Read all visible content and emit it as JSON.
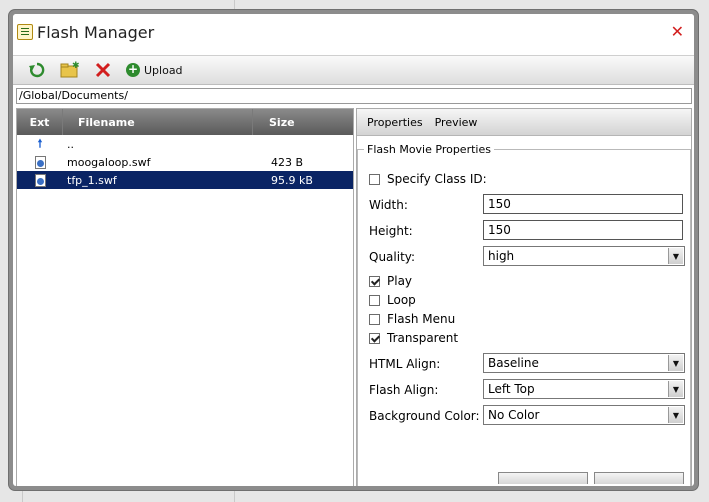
{
  "dialog": {
    "title": "Flash Manager",
    "close_icon": "close-icon"
  },
  "toolbar": {
    "refresh_icon": "refresh-icon",
    "new_folder_icon": "new-folder-icon",
    "delete_icon": "delete-icon",
    "upload_label": "Upload"
  },
  "path": {
    "value": "/Global/Documents/"
  },
  "file_list": {
    "columns": [
      "Ext",
      "Filename",
      "Size"
    ],
    "rows": [
      {
        "icon": "up-arrow-icon",
        "name": "..",
        "size": ""
      },
      {
        "icon": "swf-file-icon",
        "name": "moogaloop.swf",
        "size": "423 B"
      },
      {
        "icon": "swf-file-icon",
        "name": "tfp_1.swf",
        "size": "95.9 kB",
        "selected": true
      }
    ]
  },
  "properties": {
    "tabs": [
      "Properties",
      "Preview"
    ],
    "legend": "Flash Movie Properties",
    "specify_class_id": {
      "label": "Specify Class ID:",
      "checked": false
    },
    "width": {
      "label": "Width:",
      "value": "150"
    },
    "height": {
      "label": "Height:",
      "value": "150"
    },
    "quality": {
      "label": "Quality:",
      "value": "high"
    },
    "play": {
      "label": "Play",
      "checked": true
    },
    "loop": {
      "label": "Loop",
      "checked": false
    },
    "flash_menu": {
      "label": "Flash Menu",
      "checked": false
    },
    "transparent": {
      "label": "Transparent",
      "checked": true
    },
    "html_align": {
      "label": "HTML Align:",
      "value": "Baseline"
    },
    "flash_align": {
      "label": "Flash Align:",
      "value": "Left Top"
    },
    "background_color": {
      "label": "Background Color:",
      "value": "No Color"
    }
  }
}
